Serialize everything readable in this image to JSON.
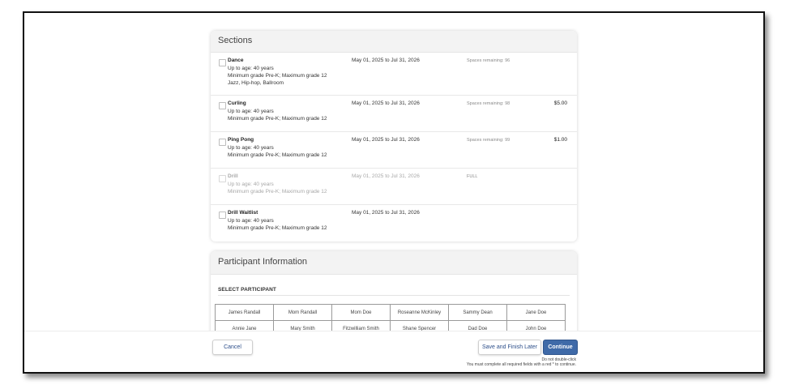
{
  "sections_card": {
    "title": "Sections",
    "items": [
      {
        "name": "Dance",
        "age": "Up to age: 40 years",
        "grade": "Minimum grade Pre-K; Maximum grade 12",
        "extra": "Jazz, Hip-hop, Ballroom",
        "dates": "May 01, 2025 to Jul 31, 2026",
        "spaces": "Spaces remaining: 96",
        "price": "",
        "disabled": false
      },
      {
        "name": "Curling",
        "age": "Up to age: 40 years",
        "grade": "Minimum grade Pre-K; Maximum grade 12",
        "extra": "",
        "dates": "May 01, 2025 to Jul 31, 2026",
        "spaces": "Spaces remaining: 98",
        "price": "$5.00",
        "disabled": false
      },
      {
        "name": "Ping Pong",
        "age": "Up to age: 40 years",
        "grade": "Minimum grade Pre-K; Maximum grade 12",
        "extra": "",
        "dates": "May 01, 2025 to Jul 31, 2026",
        "spaces": "Spaces remaining: 99",
        "price": "$1.00",
        "disabled": false
      },
      {
        "name": "Drill",
        "age": "Up to age: 40 years",
        "grade": "Minimum grade Pre-K; Maximum grade 12",
        "extra": "",
        "dates": "May 01, 2025 to Jul 31, 2026",
        "spaces": "FULL",
        "price": "",
        "disabled": true
      },
      {
        "name": "Drill Waitlist",
        "age": "Up to age: 40 years",
        "grade": "Minimum grade Pre-K; Maximum grade 12",
        "extra": "",
        "dates": "May 01, 2025 to Jul 31, 2026",
        "spaces": "",
        "price": "",
        "disabled": false
      }
    ]
  },
  "participant_card": {
    "title": "Participant Information",
    "select_label": "SELECT PARTICIPANT",
    "participants": [
      [
        "James Randall",
        "Mom Randall",
        "Mom Doe",
        "Roseanne McKinley",
        "Sammy Dean",
        "Jane Doe"
      ],
      [
        "Annie Jane",
        "Mary Smith",
        "Fitzwilliam Smith",
        "Shane Spencer",
        "Dad Doe",
        "John Doe"
      ]
    ]
  },
  "footer": {
    "cancel_label": "Cancel",
    "save_label": "Save and Finish Later",
    "continue_label": "Continue",
    "note_double_click": "Do not double-click",
    "note_required": "You must complete all required fields with a red * to continue."
  },
  "colors": {
    "primary": "#3f6aa8",
    "link": "#2d4f8a",
    "header_bg": "#f3f3f3"
  }
}
